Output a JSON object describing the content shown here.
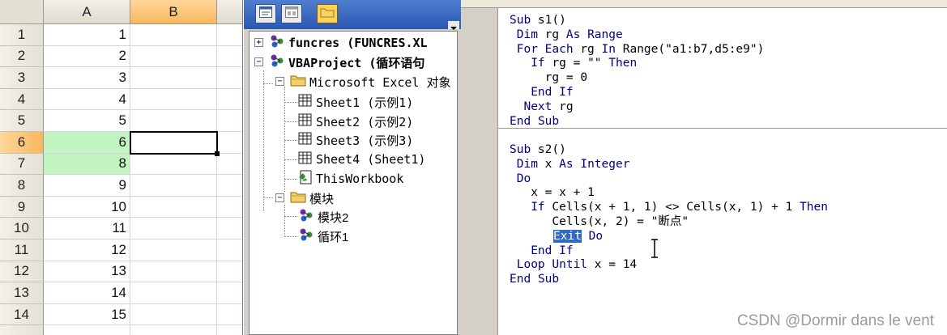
{
  "spreadsheet": {
    "columns": [
      "A",
      "B"
    ],
    "selected_column": "B",
    "rows": [
      {
        "row": "1",
        "a": "1"
      },
      {
        "row": "2",
        "a": "2"
      },
      {
        "row": "3",
        "a": "3"
      },
      {
        "row": "4",
        "a": "4"
      },
      {
        "row": "5",
        "a": "5"
      },
      {
        "row": "6",
        "a": "6"
      },
      {
        "row": "7",
        "a": "8"
      },
      {
        "row": "8",
        "a": "9"
      },
      {
        "row": "9",
        "a": "10"
      },
      {
        "row": "10",
        "a": "11"
      },
      {
        "row": "11",
        "a": "12"
      },
      {
        "row": "12",
        "a": "13"
      },
      {
        "row": "13",
        "a": "14"
      },
      {
        "row": "14",
        "a": "15"
      }
    ],
    "highlight_color": "#c2f4c2",
    "selected_row": "6"
  },
  "project_explorer": {
    "toolbar": {
      "view_code_icon": "view-code-icon",
      "view_object_icon": "view-object-icon",
      "toggle_folders_icon": "folder-icon"
    },
    "tree": {
      "funcres": "funcres (FUNCRES.XL",
      "vbaproject": "VBAProject (循环语句",
      "excel_objects": "Microsoft Excel 对象",
      "sheet1": "Sheet1 (示例1)",
      "sheet2": "Sheet2 (示例2)",
      "sheet3": "Sheet3 (示例3)",
      "sheet4": "Sheet4 (Sheet1)",
      "thisworkbook": "ThisWorkbook",
      "modules": "模块",
      "module1": "模块2",
      "module2": "循环1"
    }
  },
  "code_window": {
    "lines1": [
      "Sub s1()",
      " Dim rg As Range",
      " For Each rg In Range(\"a1:b7,d5:e9\")",
      "   If rg = \"\" Then",
      "     rg = 0",
      "   End If",
      "  Next rg",
      "End Sub"
    ],
    "lines2": [
      "Sub s2()",
      " Dim x As Integer",
      " Do",
      "   x = x + 1",
      "   If Cells(x + 1, 1) <> Cells(x, 1) + 1 Then",
      "      Cells(x, 2) = \"断点\"",
      "Exit Do",
      "   End If",
      " Loop Until x = 14",
      "End Sub"
    ],
    "highlighted_word": "Exit",
    "watermark": "CSDN @Dormir dans le vent"
  }
}
